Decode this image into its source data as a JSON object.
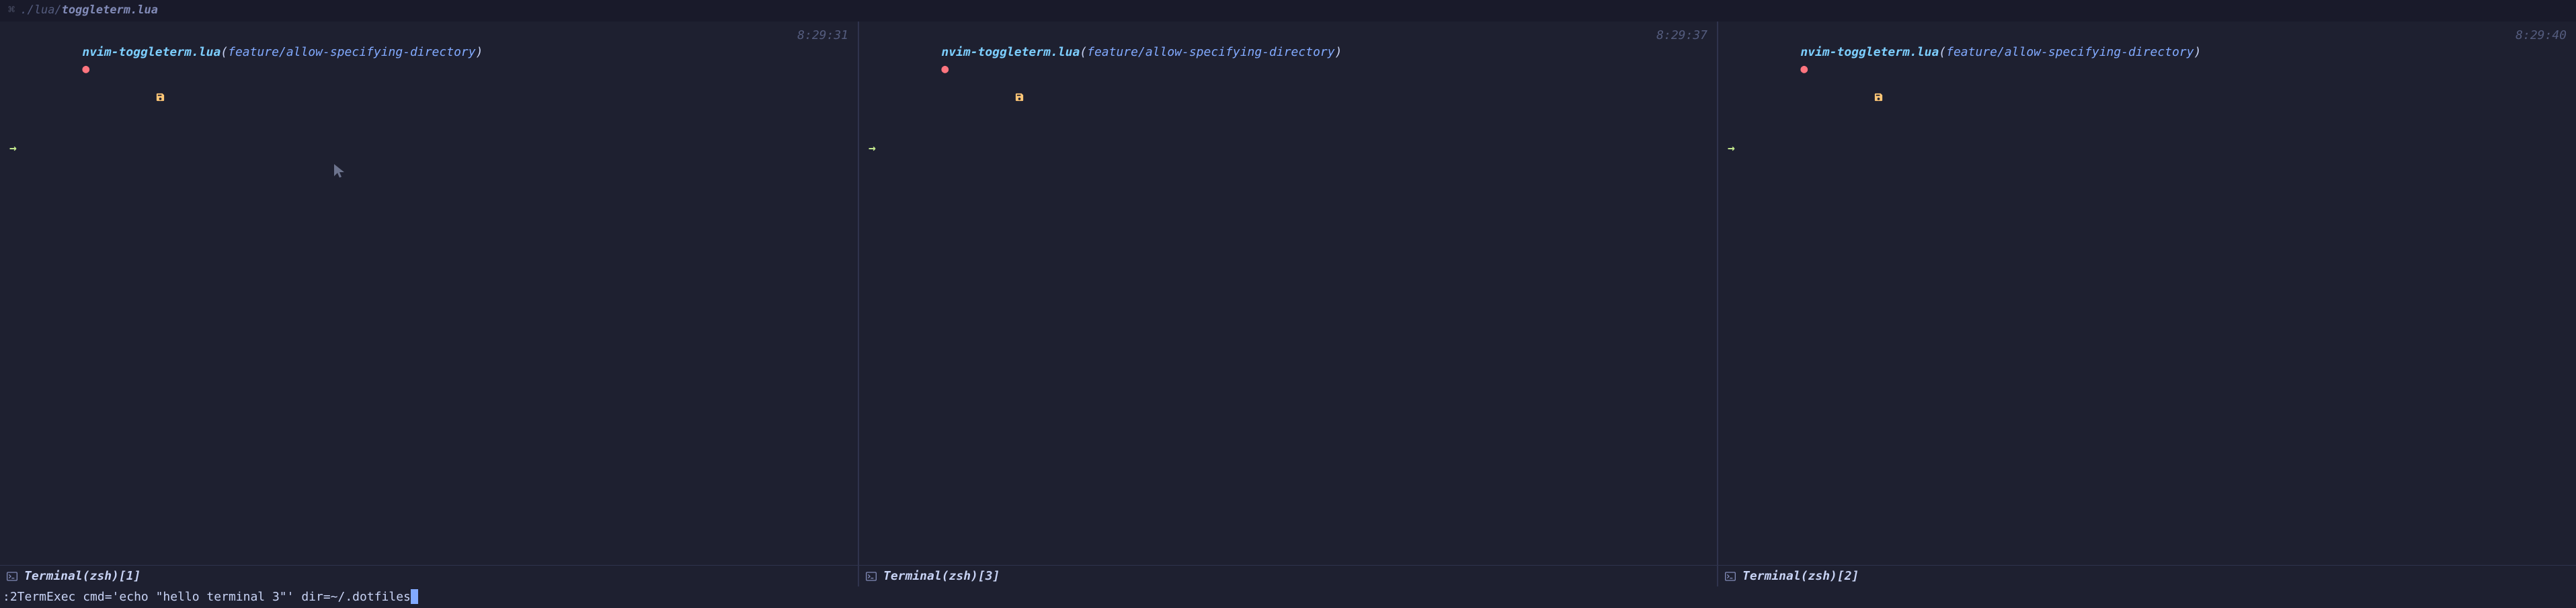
{
  "titlebar": {
    "icon": "⌘",
    "path_prefix": "./lua/",
    "filename": "toggleterm.lua"
  },
  "panes": [
    {
      "repo": "nvim-toggleterm.lua",
      "branch": "feature/allow-specifying-directory",
      "time": "8:29:31",
      "status_label": "Terminal(zsh)[1]",
      "show_mouse": true
    },
    {
      "repo": "nvim-toggleterm.lua",
      "branch": "feature/allow-specifying-directory",
      "time": "8:29:37",
      "status_label": "Terminal(zsh)[3]",
      "show_mouse": false
    },
    {
      "repo": "nvim-toggleterm.lua",
      "branch": "feature/allow-specifying-directory",
      "time": "8:29:40",
      "status_label": "Terminal(zsh)[2]",
      "show_mouse": false
    }
  ],
  "cmdline": {
    "text": ":2TermExec cmd='echo \"hello terminal 3\"' dir=~/.dotfiles"
  },
  "glyphs": {
    "dot": "●",
    "arrow": "→"
  }
}
